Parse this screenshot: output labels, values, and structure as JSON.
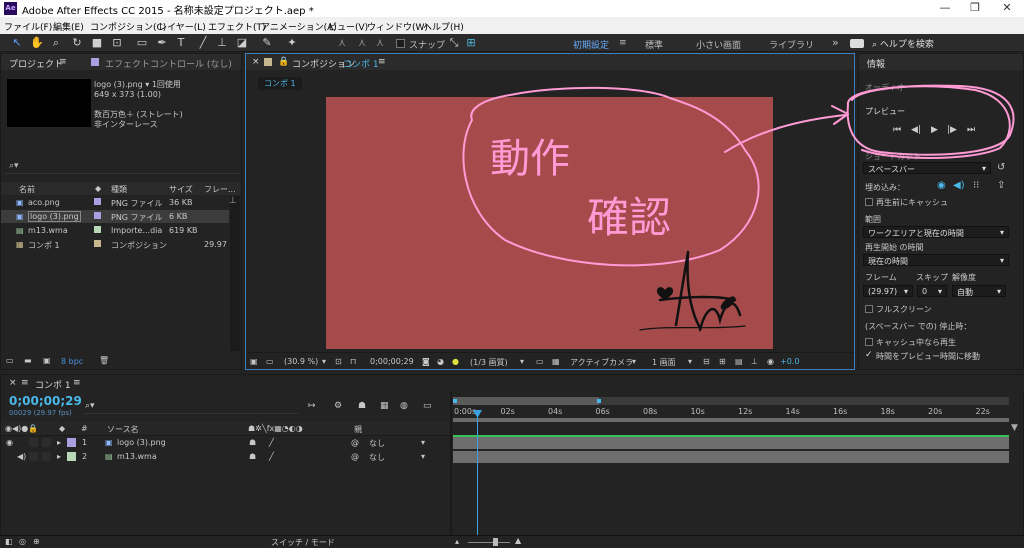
{
  "title_bar": {
    "app_icon": "Ae",
    "title": "Adobe After Effects CC 2015 - 名称未設定プロジェクト.aep *",
    "minimize": "—",
    "maximize": "❐",
    "close": "✕"
  },
  "menu": [
    "ファイル(F)",
    "編集(E)",
    "コンポジション(C)",
    "レイヤー(L)",
    "エフェクト(T)",
    "アニメーション(A)",
    "ビュー(V)",
    "ウィンドウ(W)",
    "ヘルプ(H)"
  ],
  "toolbar": {
    "snap_label": "スナップ",
    "workspaces": [
      "初期設定",
      "標準",
      "小さい画面",
      "ライブラリ"
    ],
    "more": "»",
    "search_help": "ヘルプを検索"
  },
  "project": {
    "tab_project": "プロジェクト",
    "tab_effects": "エフェクトコントロール (なし)",
    "selected_name": "logo (3).png ▾  1回使用",
    "selected_dims": "649 x 373 (1.00)",
    "selected_color": "数百万色＋ (ストレート)",
    "selected_interlace": "非インターレース",
    "search_placeholder": "",
    "columns": {
      "name": "名前",
      "type": "種類",
      "size": "サイズ",
      "frame": "フレー..."
    },
    "items": [
      {
        "name": "aco.png",
        "type": "PNG ファイル",
        "size": "36 KB",
        "frame": "",
        "color": "#a8a0e0",
        "icon": "image-file-icon"
      },
      {
        "name": "logo (3).png",
        "type": "PNG ファイル",
        "size": "6 KB",
        "frame": "",
        "color": "#a8a0e0",
        "icon": "image-file-icon"
      },
      {
        "name": "m13.wma",
        "type": "Importe...dia",
        "size": "619 KB",
        "frame": "",
        "color": "#b8d8b8",
        "icon": "audio-file-icon"
      },
      {
        "name": "コンポ 1",
        "type": "コンポジション",
        "size": "",
        "frame": "29.97",
        "color": "#c8b890",
        "icon": "composition-icon"
      }
    ],
    "bpc": "8 bpc"
  },
  "viewer": {
    "tab": "コンポジション",
    "tab_comp": "コンポ 1",
    "sub_tab": "コンポ 1",
    "canvas_color": "#a64b4b",
    "bar": {
      "zoom": "(30.9 %)",
      "timecode": "0;00;00;29",
      "resolution": "(1/3 画質)",
      "camera": "アクティブカメラ",
      "views": "1 画面",
      "exposure": "+0.0"
    }
  },
  "right_panel": {
    "tab_info": "情報",
    "tab_audio": "オーディオ",
    "preview_title": "プレビュー",
    "shortcut_label": "ショートカット",
    "shortcut_value": "スペースバー",
    "include_label": "埋め込み：",
    "cache_before": "再生前にキャッシュ",
    "range_label": "範囲",
    "range_value": "ワークエリアと現在の時間",
    "play_from_label": "再生開始 の時間",
    "play_from_value": "現在の時間",
    "frame_label": "フレーム",
    "skip_label": "スキップ",
    "res_label": "解像度",
    "frame_value": "(29.97)",
    "skip_value": "0",
    "res_value": "自動",
    "fullscreen": "フルスクリーン",
    "on_stop_label": "(スペースバー での) 停止時：",
    "cache_play": "キャッシュ中なら再生",
    "move_time": "時間をプレビュー時間に移動"
  },
  "timeline": {
    "tab": "コンポ 1",
    "timecode": "0;00;00;29",
    "fps": "00029 (29.97 fps)",
    "search_placeholder": "",
    "header": {
      "index": "#",
      "source": "ソース名",
      "parent": "親"
    },
    "layers": [
      {
        "index": "1",
        "name": "logo (3).png",
        "parent": "なし",
        "color": "#a8a0e0",
        "icon": "image-file-icon"
      },
      {
        "index": "2",
        "name": "m13.wma",
        "parent": "なし",
        "color": "#b8d8b8",
        "icon": "audio-file-icon"
      }
    ],
    "ruler": [
      "0:00s",
      "02s",
      "04s",
      "06s",
      "08s",
      "10s",
      "12s",
      "14s",
      "16s",
      "18s",
      "20s",
      "22s"
    ],
    "switch_mode": "スイッチ / モード"
  },
  "annotation": {
    "line1": "動作",
    "line2": "確認",
    "color": "#ff9ad5"
  }
}
